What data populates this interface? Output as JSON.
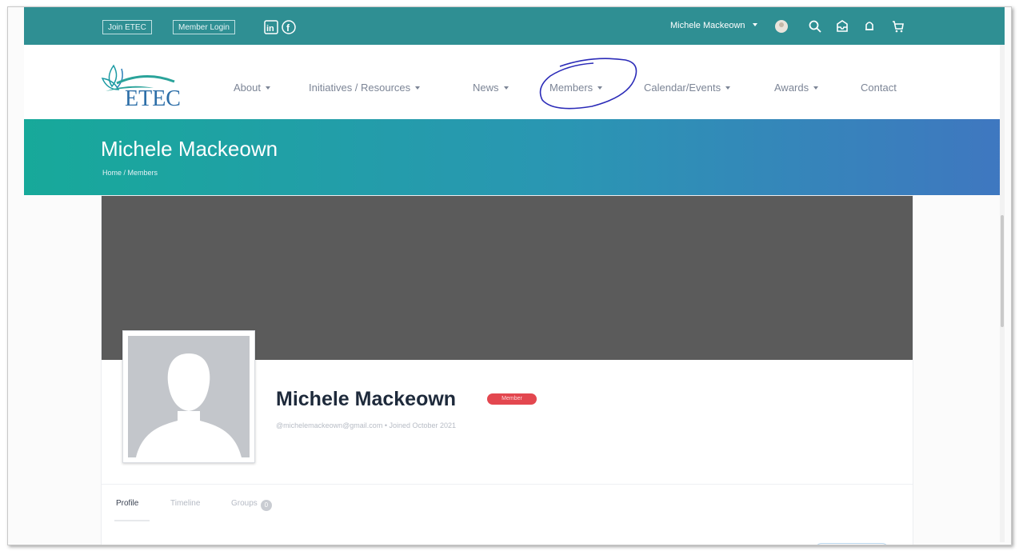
{
  "topbar": {
    "join_label": "Join ETEC",
    "login_label": "Member Login",
    "user_name": "Michele Mackeown",
    "icons": [
      "linkedin-icon",
      "facebook-icon",
      "avatar",
      "search-icon",
      "inbox-icon",
      "bell-icon",
      "cart-icon"
    ],
    "color": "#2f8f93"
  },
  "nav": {
    "logo_text": "ETEC",
    "items": [
      {
        "label": "About",
        "dropdown": true
      },
      {
        "label": "Initiatives / Resources",
        "dropdown": true
      },
      {
        "label": "News",
        "dropdown": true
      },
      {
        "label": "Members",
        "dropdown": true
      },
      {
        "label": "Calendar/Events",
        "dropdown": true
      },
      {
        "label": "Awards",
        "dropdown": true
      },
      {
        "label": "Contact",
        "dropdown": false
      }
    ],
    "annotation_color": "#2b2bb8"
  },
  "header": {
    "title": "Michele Mackeown",
    "breadcrumb": "Home / Members",
    "gradient": [
      "#17a99a",
      "#3f77c0"
    ]
  },
  "profile": {
    "name": "Michele Mackeown",
    "badge": "Member",
    "meta": "@michelemackeown@gmail.com • Joined October 2021",
    "cover_color": "#5b5b5b",
    "badge_color": "#e3474f"
  },
  "tabs": [
    {
      "label": "Profile",
      "active": true
    },
    {
      "label": "Timeline",
      "active": false
    },
    {
      "label": "Groups",
      "active": false,
      "count": "0"
    }
  ]
}
